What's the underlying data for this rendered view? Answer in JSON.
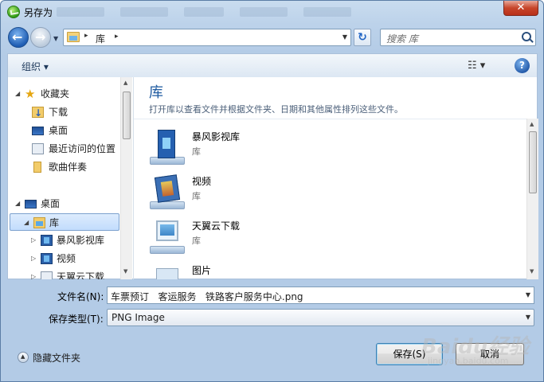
{
  "window": {
    "title": "另存为",
    "close_glyph": "✕"
  },
  "address_bar": {
    "current": "库",
    "separator": "▸"
  },
  "search": {
    "placeholder": "搜索 库"
  },
  "toolbar": {
    "organize_label": "组织 ▾",
    "views_glyph": "☷ ▾",
    "help_label": "?"
  },
  "nav_pane": {
    "items": [
      {
        "label": "收藏夹",
        "icon": "star-icon"
      },
      {
        "label": "下载",
        "icon": "downloads-folder-icon"
      },
      {
        "label": "桌面",
        "icon": "desktop-icon"
      },
      {
        "label": "最近访问的位置",
        "icon": "recent-places-icon"
      },
      {
        "label": "歌曲伴奏",
        "icon": "folder-icon"
      },
      {
        "label": "桌面",
        "icon": "desktop-icon"
      },
      {
        "label": "库",
        "icon": "libraries-icon",
        "selected": true
      },
      {
        "label": "暴风影视库",
        "icon": "video-library-icon"
      },
      {
        "label": "视频",
        "icon": "video-library-icon"
      },
      {
        "label": "天翼云下载",
        "icon": "cloud-download-icon"
      }
    ]
  },
  "main_pane": {
    "title": "库",
    "subtitle": "打开库以查看文件并根据文件夹、日期和其他属性排列这些文件。",
    "libraries": [
      {
        "name": "暴风影视库",
        "type": "库",
        "icon": "video-library-icon"
      },
      {
        "name": "视频",
        "type": "库",
        "icon": "videos-library-icon"
      },
      {
        "name": "天翼云下载",
        "type": "库",
        "icon": "cloud-download-library-icon"
      },
      {
        "name": "图片",
        "type": "",
        "icon": "pictures-library-icon"
      }
    ]
  },
  "form": {
    "filename_label": "文件名(N):",
    "filename_value": "车票预订   客运服务   铁路客户服务中心.png",
    "filetype_label": "保存类型(T):",
    "filetype_value": "PNG Image"
  },
  "footer": {
    "hide_folders_label": "隐藏文件夹",
    "save_label": "保存(S)",
    "cancel_label": "取消"
  },
  "watermark": {
    "brand": "Baidu经验",
    "url": "jingyan.baidu.com"
  }
}
